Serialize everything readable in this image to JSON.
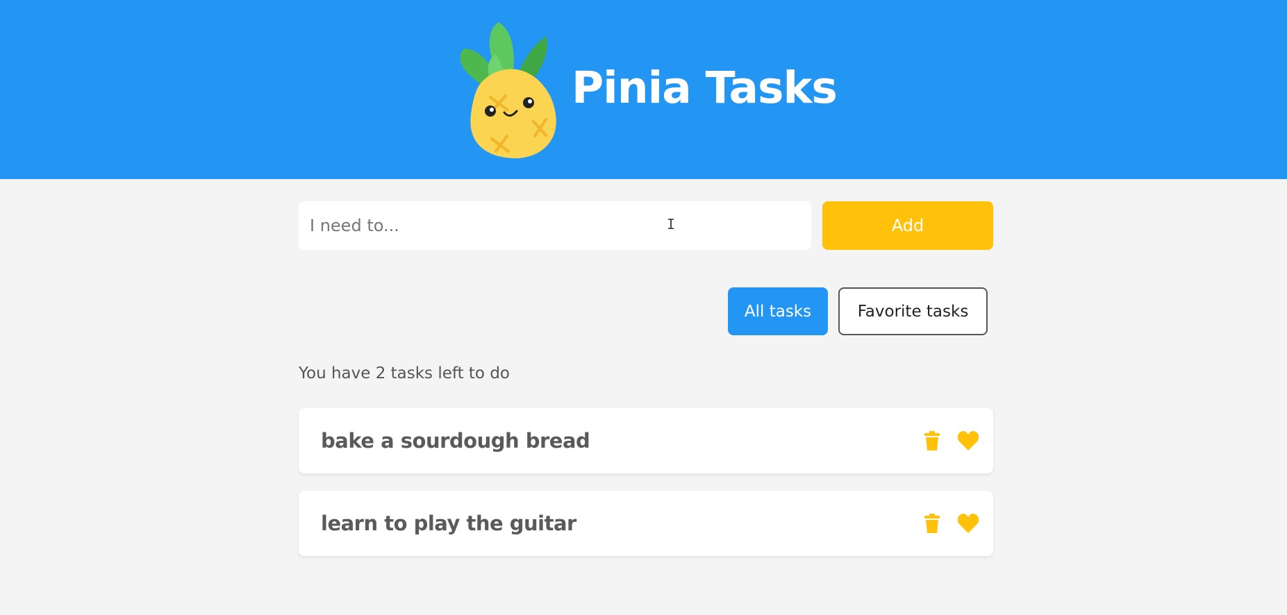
{
  "header": {
    "title": "Pinia Tasks",
    "logo_icon": "pineapple-icon",
    "background_color": "#2396f3"
  },
  "new_task": {
    "placeholder": "I need to...",
    "value": "",
    "add_label": "Add",
    "add_color": "#ffc10a"
  },
  "filters": {
    "all_label": "All tasks",
    "favorite_label": "Favorite tasks",
    "active": "all"
  },
  "summary": {
    "tasks_left_text": "You have 2 tasks left to do"
  },
  "tasks": [
    {
      "title": "bake a sourdough bread",
      "delete_icon": "trash-icon",
      "favorite_icon": "heart-icon"
    },
    {
      "title": "learn to play the guitar",
      "delete_icon": "trash-icon",
      "favorite_icon": "heart-icon"
    }
  ],
  "colors": {
    "accent": "#ffc10a",
    "primary": "#2396f3",
    "page_bg": "#f4f4f4"
  }
}
